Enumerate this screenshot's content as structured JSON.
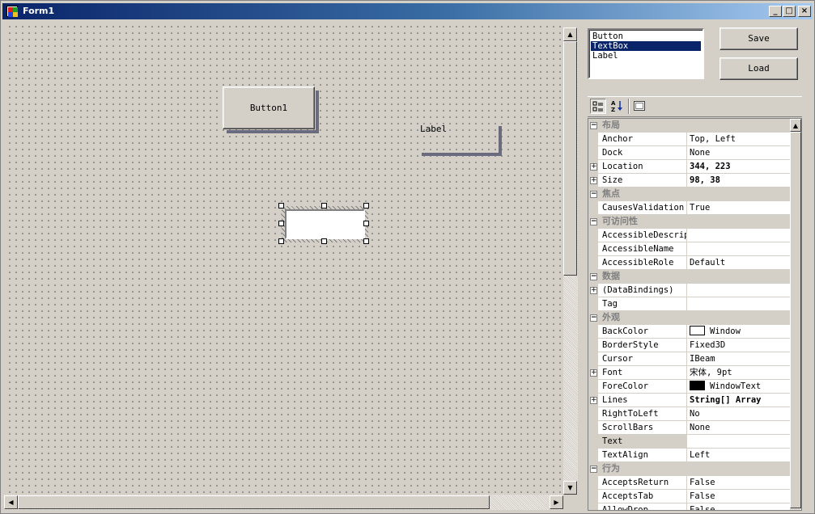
{
  "window": {
    "title": "Form1",
    "controls": {
      "minimize": "_",
      "maximize": "□",
      "close": "×"
    }
  },
  "designer": {
    "button1_text": "Button1",
    "label_text": "Label"
  },
  "toolbox_list": {
    "items": [
      "Button",
      "TextBox",
      "Label"
    ],
    "selected": "TextBox"
  },
  "buttons": {
    "save": "Save",
    "load": "Load"
  },
  "property_toolbar": {
    "icons": [
      "categorized-icon",
      "alphabetical-icon",
      "property-pages-icon"
    ],
    "alphabetical_glyph": "A↓Z"
  },
  "property_grid": {
    "rows": [
      {
        "type": "category",
        "name": "布局"
      },
      {
        "type": "prop",
        "name": "Anchor",
        "value": "Top, Left"
      },
      {
        "type": "prop",
        "name": "Dock",
        "value": "None"
      },
      {
        "type": "prop",
        "name": "Location",
        "value": "344, 223",
        "expandable": true,
        "bold": true
      },
      {
        "type": "prop",
        "name": "Size",
        "value": "98, 38",
        "expandable": true,
        "bold": true
      },
      {
        "type": "category",
        "name": "焦点"
      },
      {
        "type": "prop",
        "name": "CausesValidation",
        "value": "True"
      },
      {
        "type": "category",
        "name": "可访问性"
      },
      {
        "type": "prop",
        "name": "AccessibleDescrip",
        "value": ""
      },
      {
        "type": "prop",
        "name": "AccessibleName",
        "value": ""
      },
      {
        "type": "prop",
        "name": "AccessibleRole",
        "value": "Default"
      },
      {
        "type": "category",
        "name": "数据"
      },
      {
        "type": "prop",
        "name": "(DataBindings)",
        "value": "",
        "expandable": true
      },
      {
        "type": "prop",
        "name": "Tag",
        "value": ""
      },
      {
        "type": "category",
        "name": "外观"
      },
      {
        "type": "prop",
        "name": "BackColor",
        "value": "Window",
        "swatch": "#ffffff"
      },
      {
        "type": "prop",
        "name": "BorderStyle",
        "value": "Fixed3D"
      },
      {
        "type": "prop",
        "name": "Cursor",
        "value": "IBeam"
      },
      {
        "type": "prop",
        "name": "Font",
        "value": "宋体, 9pt",
        "expandable": true
      },
      {
        "type": "prop",
        "name": "ForeColor",
        "value": "WindowText",
        "swatch": "#000000"
      },
      {
        "type": "prop",
        "name": "Lines",
        "value": "String[] Array",
        "expandable": true,
        "bold": true
      },
      {
        "type": "prop",
        "name": "RightToLeft",
        "value": "No"
      },
      {
        "type": "prop",
        "name": "ScrollBars",
        "value": "None"
      },
      {
        "type": "prop",
        "name": "Text",
        "value": "",
        "selected": true
      },
      {
        "type": "prop",
        "name": "TextAlign",
        "value": "Left"
      },
      {
        "type": "category",
        "name": "行为"
      },
      {
        "type": "prop",
        "name": "AcceptsReturn",
        "value": "False"
      },
      {
        "type": "prop",
        "name": "AcceptsTab",
        "value": "False"
      },
      {
        "type": "prop",
        "name": "AllowDrop",
        "value": "False"
      }
    ]
  },
  "colors": {
    "titlebar_start": "#0a246a",
    "titlebar_end": "#a6caf0",
    "selection": "#0a246a",
    "face": "#d4d0c8"
  }
}
